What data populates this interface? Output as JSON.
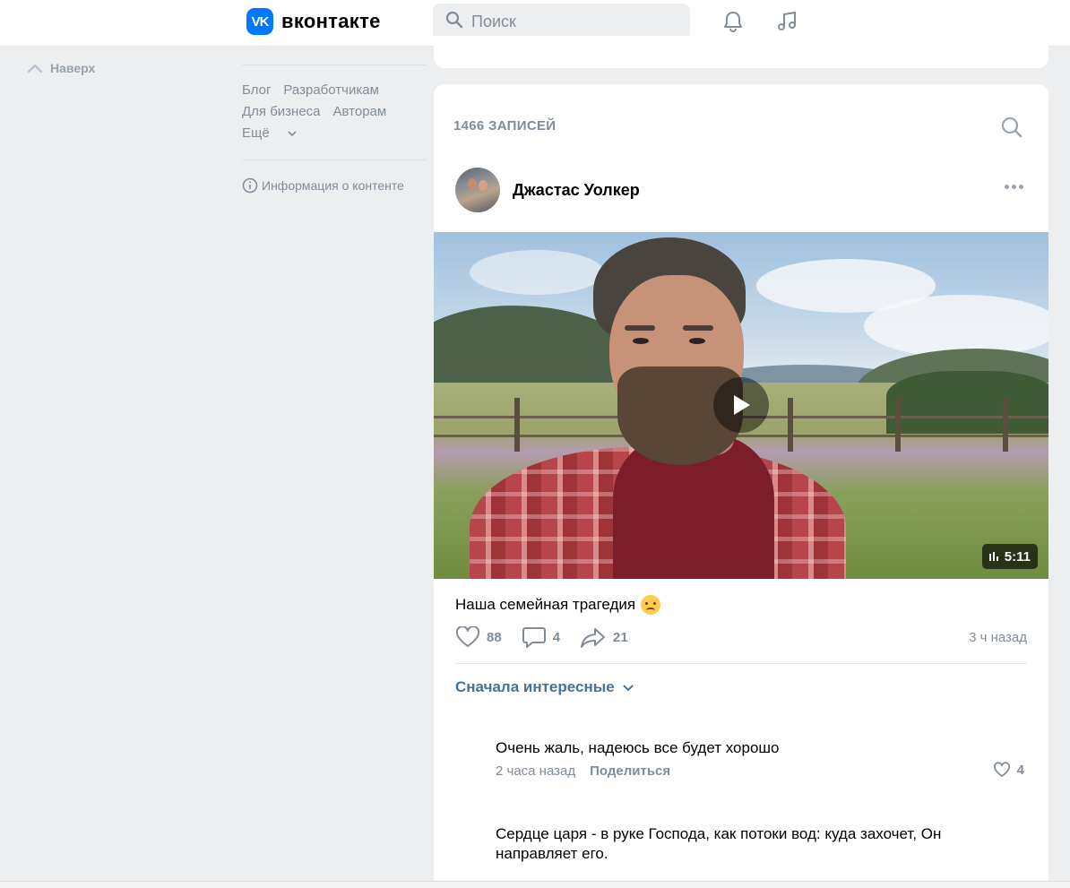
{
  "header": {
    "logo_text": "вконтакте",
    "logo_mark": "VK",
    "search_placeholder": "Поиск",
    "icons": [
      "bell-icon",
      "music-icon"
    ]
  },
  "left": {
    "up_label": "Наверх",
    "footer_links": [
      "Блог",
      "Разработчикам",
      "Для бизнеса",
      "Авторам"
    ],
    "more_label": "Ещё",
    "info_label": "Информация о контенте"
  },
  "wall": {
    "count_label": "1466 ЗАПИСЕЙ",
    "post": {
      "author": "Джастас Уолкер",
      "video_duration": "5:11",
      "text": "Наша семейная трагедия",
      "likes": "88",
      "comments": "4",
      "shares": "21",
      "time": "3 ч назад"
    },
    "sort_label": "Сначала интересные",
    "comments": [
      {
        "text": "Очень жаль, надеюсь все будет хорошо",
        "time": "2 часа назад",
        "share": "Поделиться",
        "likes": "4"
      },
      {
        "text": "Сердце царя - в руке Господа, как потоки вод: куда захочет, Он направляет его."
      }
    ]
  },
  "colors": {
    "brand": "#0077ff",
    "link": "#44729e",
    "muted": "#818c99",
    "background": "#edeef0"
  }
}
